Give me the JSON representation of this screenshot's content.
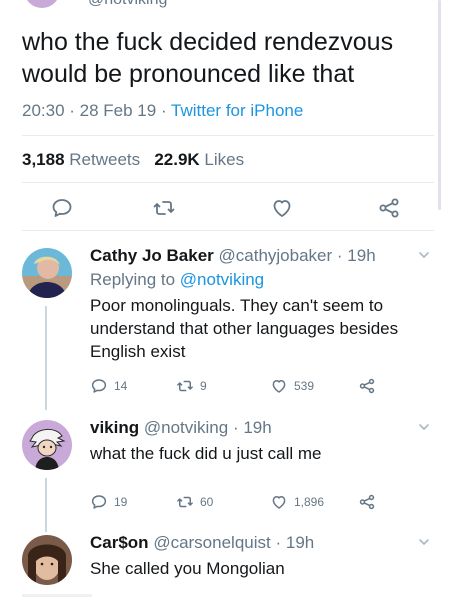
{
  "top": {
    "handle_partial": "@notviking"
  },
  "tweet": {
    "text": "who the fuck decided rendezvous would be pronounced like that",
    "time": "20:30",
    "sep1": " · ",
    "date": "28 Feb 19",
    "sep2": " · ",
    "source": "Twitter for iPhone",
    "retweets_count": "3,188",
    "retweets_label": " Retweets",
    "likes_count": "22.9K",
    "likes_label": " Likes"
  },
  "icons": {
    "reply": "reply-icon",
    "retweet": "retweet-icon",
    "like": "heart-icon",
    "share": "share-icon"
  },
  "replies": [
    {
      "name": "Cathy Jo Baker",
      "handle": "@cathyjobaker",
      "time": "19h",
      "sep": " · ",
      "replying_prefix": "Replying to ",
      "replying_to": "@notviking",
      "text": "Poor monolinguals. They can't seem to understand that other languages besides English exist",
      "reply_count": "14",
      "retweet_count": "9",
      "like_count": "539",
      "avatar_color": "#6bb8d8"
    },
    {
      "name": "viking",
      "handle": "@notviking",
      "time": "19h",
      "sep": " · ",
      "text": "what the fuck did u just call me",
      "reply_count": "19",
      "retweet_count": "60",
      "like_count": "1,896",
      "avatar_color": "#c9a9d8"
    },
    {
      "name": "Car$on",
      "handle": "@carsonelquist",
      "time": "19h",
      "sep": " · ",
      "text": "She called you Mongolian",
      "avatar_color": "#7a5a48"
    }
  ],
  "colors": {
    "link": "#1b95e0",
    "secondary": "#657786",
    "primary": "#14171a",
    "divider": "#e6ecf0"
  }
}
